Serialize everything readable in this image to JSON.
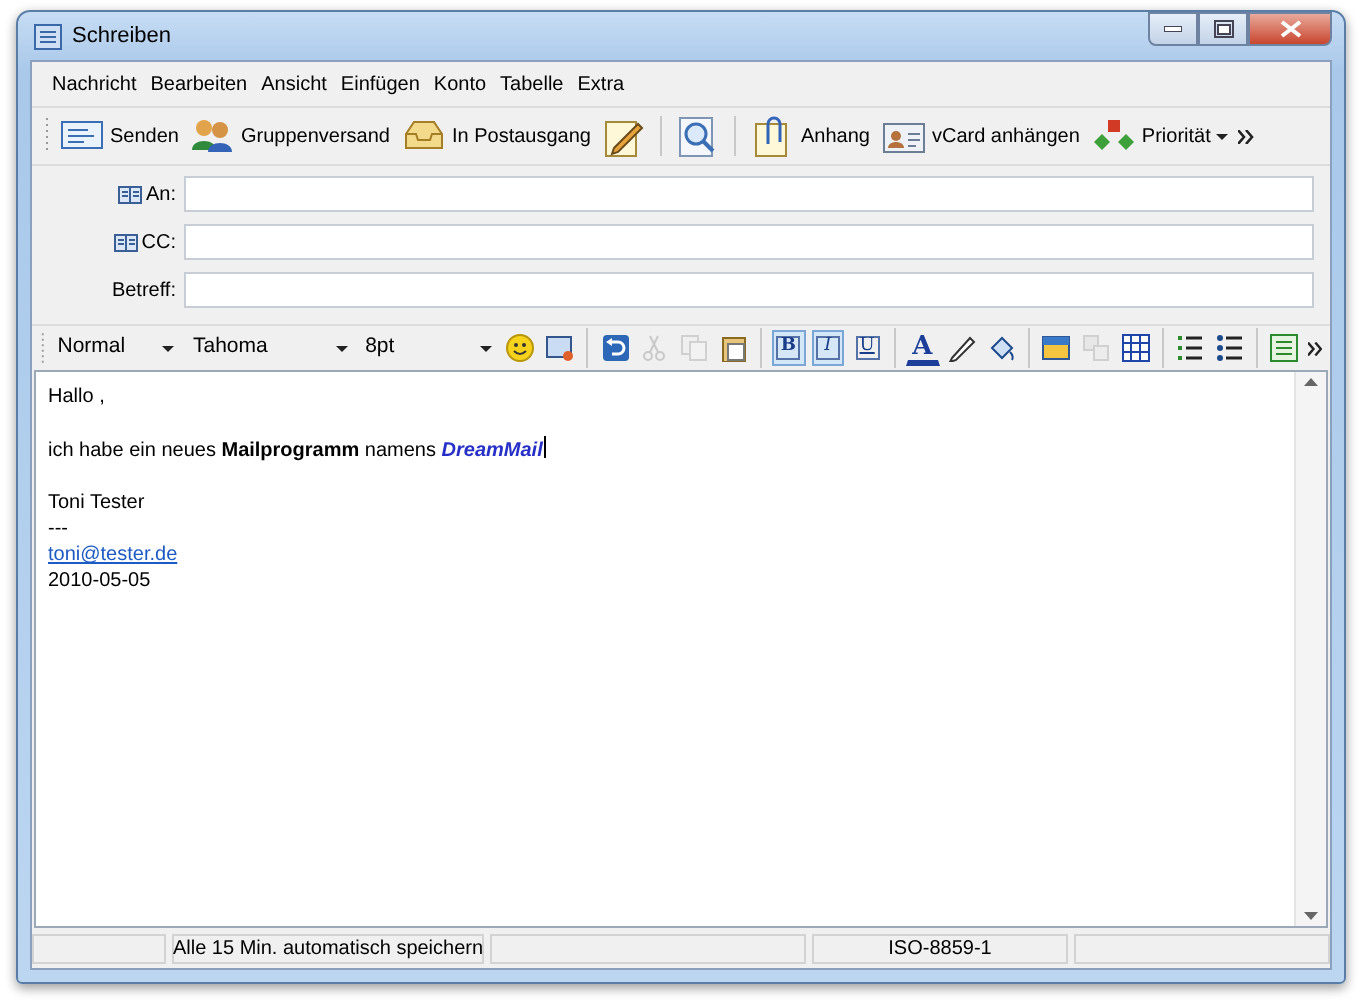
{
  "window": {
    "title": "Schreiben"
  },
  "menu": [
    "Nachricht",
    "Bearbeiten",
    "Ansicht",
    "Einfügen",
    "Konto",
    "Tabelle",
    "Extra"
  ],
  "toolbar": [
    {
      "kind": "button",
      "label": "Senden"
    },
    {
      "kind": "button",
      "label": "Gruppenversand"
    },
    {
      "kind": "button",
      "label": "In Postausgang"
    },
    {
      "kind": "icon"
    },
    {
      "kind": "separator"
    },
    {
      "kind": "icon"
    },
    {
      "kind": "separator"
    },
    {
      "kind": "button",
      "label": "Anhang"
    },
    {
      "kind": "button",
      "label": "vCard anhängen"
    },
    {
      "kind": "dropdown",
      "label": "Priorität"
    }
  ],
  "header_fields": [
    {
      "label": "An:",
      "address_book": true
    },
    {
      "label": "CC:",
      "address_book": true
    },
    {
      "label": "Betreff:",
      "address_book": false
    }
  ],
  "format_bar": {
    "combos": [
      {
        "value": "Normal"
      },
      {
        "value": "Tahoma"
      },
      {
        "value": "8pt"
      }
    ],
    "items": [
      {
        "kind": "icon",
        "disabled": false
      },
      {
        "kind": "icon",
        "disabled": false
      },
      {
        "kind": "separator"
      },
      {
        "kind": "icon",
        "disabled": false
      },
      {
        "kind": "icon",
        "disabled": true
      },
      {
        "kind": "icon",
        "disabled": true
      },
      {
        "kind": "icon",
        "disabled": false
      },
      {
        "kind": "separator"
      },
      {
        "kind": "toggle",
        "label": "B",
        "selected": true
      },
      {
        "kind": "toggle",
        "label": "I",
        "selected": true
      },
      {
        "kind": "toggle",
        "label": "U",
        "selected": false
      },
      {
        "kind": "separator"
      },
      {
        "kind": "color",
        "label": "A"
      },
      {
        "kind": "icon",
        "disabled": false
      },
      {
        "kind": "icon",
        "disabled": false
      },
      {
        "kind": "separator"
      },
      {
        "kind": "icon",
        "disabled": false
      },
      {
        "kind": "icon",
        "disabled": true
      },
      {
        "kind": "icon",
        "disabled": false
      },
      {
        "kind": "separator"
      },
      {
        "kind": "icon",
        "disabled": false
      },
      {
        "kind": "icon",
        "disabled": false
      },
      {
        "kind": "separator"
      },
      {
        "kind": "icon",
        "disabled": false
      }
    ]
  },
  "body": [
    [
      {
        "kind": "text",
        "text": "Hallo ,"
      }
    ],
    [
      {
        "kind": "rich",
        "parts": [
          {
            "text": "ich habe ein neues ",
            "kind": "plain"
          },
          {
            "text": "Mailprogramm",
            "kind": "bold"
          },
          {
            "text": " namens ",
            "kind": "plain"
          },
          {
            "text": "DreamMail",
            "kind": "emphasis"
          }
        ]
      }
    ],
    [
      {
        "kind": "text",
        "text": "Toni Tester"
      },
      {
        "kind": "text",
        "text": "---"
      },
      {
        "kind": "link",
        "text": "toni@tester.de"
      },
      {
        "kind": "text",
        "text": "2010-05-05"
      }
    ]
  ],
  "status_bar": [
    "Alle 15 Min. automatisch speichern",
    "ISO-8859-1"
  ]
}
